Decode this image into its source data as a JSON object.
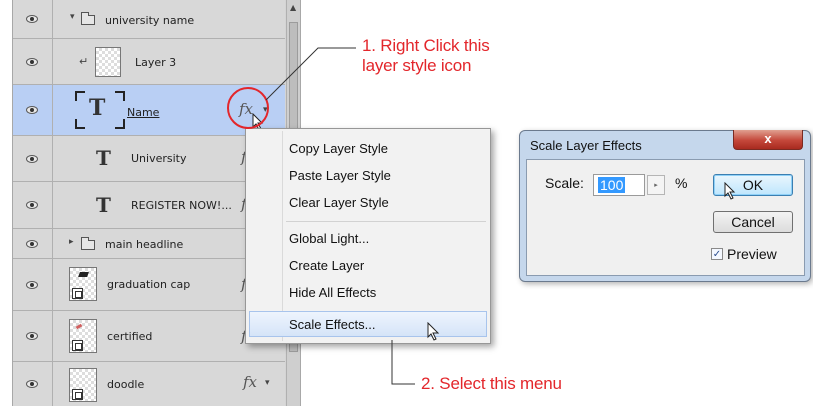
{
  "layers_panel": {
    "layers": [
      {
        "name": "university name",
        "kind": "group-open"
      },
      {
        "name": "Layer 3",
        "kind": "clipped"
      },
      {
        "name": "Name",
        "kind": "text",
        "selected": true,
        "fx": "fx"
      },
      {
        "name": "University",
        "kind": "text",
        "fx": "f"
      },
      {
        "name": "REGISTER NOW!...",
        "kind": "text",
        "fx": "f"
      },
      {
        "name": "main headline",
        "kind": "group-closed"
      },
      {
        "name": "graduation cap",
        "kind": "smart",
        "fx": "f"
      },
      {
        "name": "certified",
        "kind": "smart",
        "fx": "f"
      },
      {
        "name": "doodle",
        "kind": "smart",
        "fx": "fx"
      }
    ],
    "text_layer_glyph": "T",
    "expand_arrow": "▾",
    "collapse_arrow": "▸",
    "clip_arrow": "↵",
    "menu_arrow": "▾"
  },
  "context_menu": {
    "items": [
      "Copy Layer Style",
      "Paste Layer Style",
      "Clear Layer Style",
      "Global Light...",
      "Create Layer",
      "Hide All Effects",
      "Scale Effects..."
    ],
    "highlighted_item": "Scale Effects..."
  },
  "dialog": {
    "title": "Scale Layer Effects",
    "close_label": "x",
    "scale_label": "Scale:",
    "scale_value": "100",
    "percent": "%",
    "spinner_glyph": "▸",
    "ok_label": "OK",
    "cancel_label": "Cancel",
    "preview_label": "Preview",
    "preview_checked": true,
    "check_glyph": "✓"
  },
  "annotations": {
    "step1_line1": "1. Right Click this",
    "step1_line2": "layer style icon",
    "step2": "2. Select this menu",
    "color": "#e3262b"
  },
  "colors": {
    "panel_bg": "#d8d8d8",
    "selected_row": "#b9cff4",
    "dialog_frame": "#c5d7ec",
    "close_button": "#c4473a"
  }
}
